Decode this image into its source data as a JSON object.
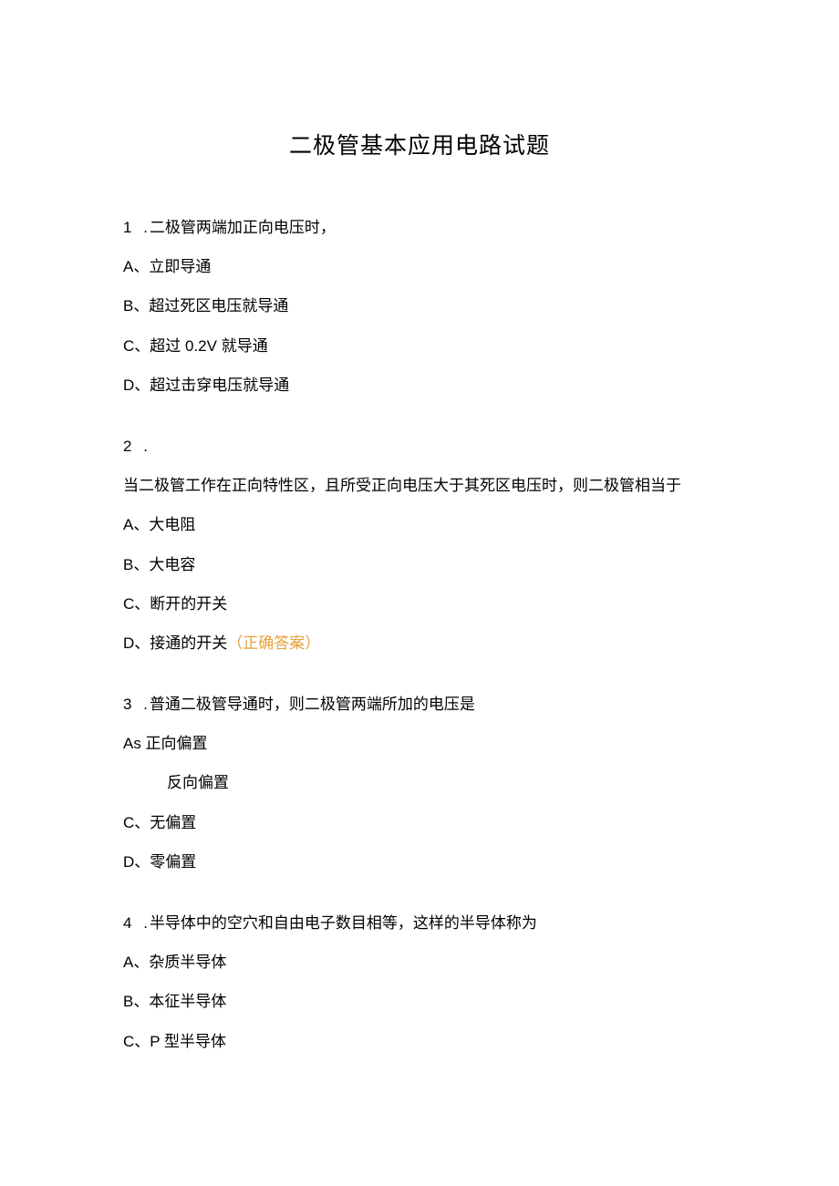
{
  "title": "二极管基本应用电路试题",
  "questions": [
    {
      "number": "1",
      "dot": ".",
      "text": "二极管两端加正向电压时，",
      "continued": "",
      "options": [
        {
          "label": "A、立即导通",
          "correct": ""
        },
        {
          "label": "B、超过死区电压就导通",
          "correct": ""
        },
        {
          "label": "C、超过 0.2V 就导通",
          "correct": ""
        },
        {
          "label": "D、超过击穿电压就导通",
          "correct": ""
        }
      ]
    },
    {
      "number": "2",
      "dot": ".",
      "text": "",
      "continued": "当二极管工作在正向特性区，且所受正向电压大于其死区电压时，则二极管相当于",
      "options": [
        {
          "label": "A、大电阻",
          "correct": ""
        },
        {
          "label": "B、大电容",
          "correct": ""
        },
        {
          "label": "C、断开的开关",
          "correct": ""
        },
        {
          "label": "D、接通的开关",
          "correct": "（正确答案）"
        }
      ]
    },
    {
      "number": "3",
      "dot": ".",
      "text": "普通二极管导通时，则二极管两端所加的电压是",
      "continued": "",
      "options": [
        {
          "label": "As 正向偏置",
          "correct": ""
        },
        {
          "label_indent": "反向偏置",
          "correct": ""
        },
        {
          "label": "C、无偏置",
          "correct": ""
        },
        {
          "label": "D、零偏置",
          "correct": ""
        }
      ]
    },
    {
      "number": "4",
      "dot": ".",
      "text": "半导体中的空穴和自由电子数目相等，这样的半导体称为",
      "continued": "",
      "options": [
        {
          "label": "A、杂质半导体",
          "correct": ""
        },
        {
          "label": "B、本征半导体",
          "correct": ""
        },
        {
          "label": "C、P 型半导体",
          "correct": ""
        }
      ]
    }
  ]
}
